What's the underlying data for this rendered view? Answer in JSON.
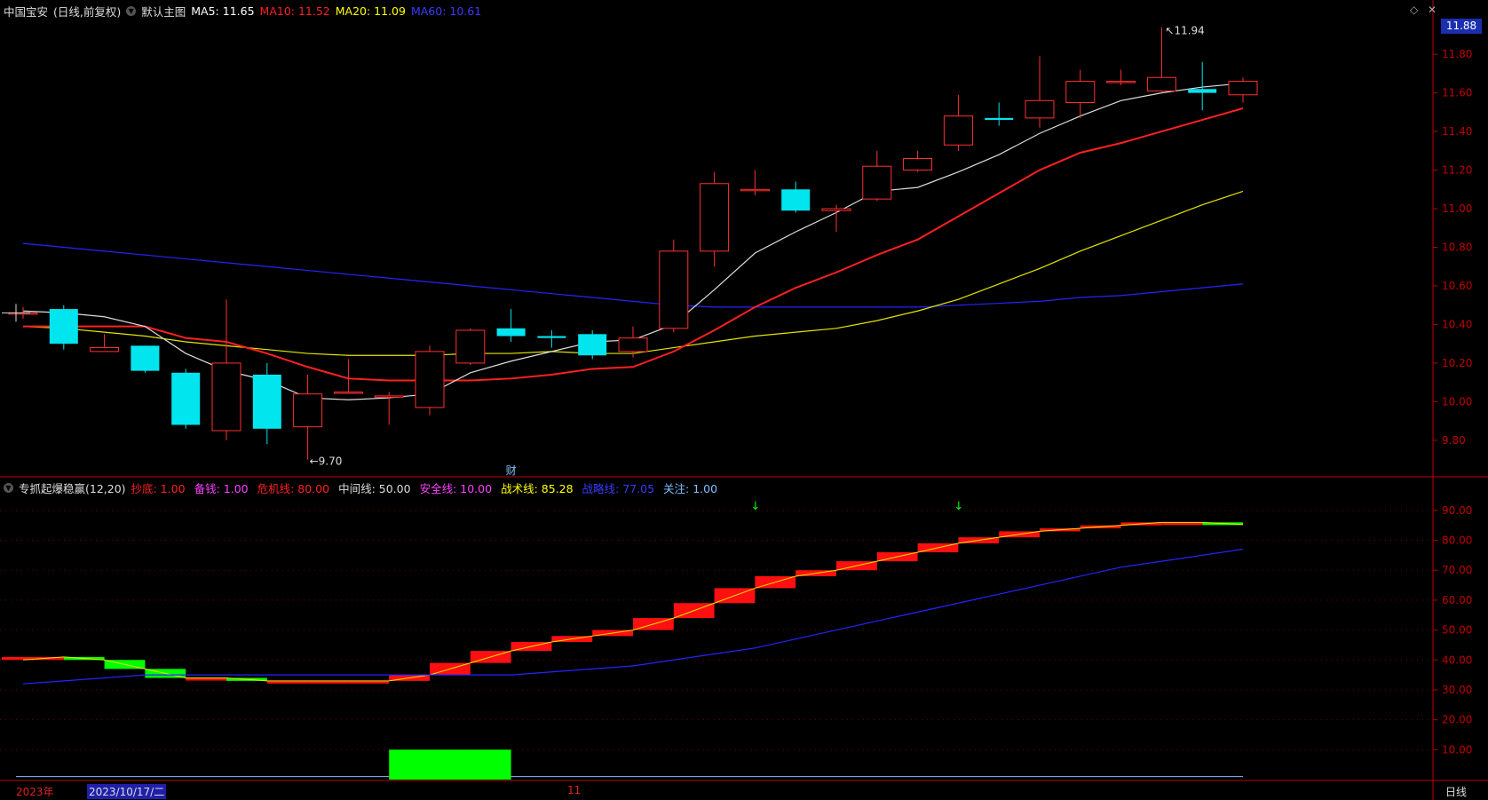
{
  "header": {
    "stock": "中国宝安",
    "mode": "(日线,前复权)",
    "chart_name": "默认主图",
    "ma": [
      {
        "label": "MA5: 11.65",
        "color": "#ffffff"
      },
      {
        "label": "MA10: 11.52",
        "color": "#ff2020"
      },
      {
        "label": "MA20: 11.09",
        "color": "#ffff00"
      },
      {
        "label": "MA60: 10.61",
        "color": "#3a3aff"
      }
    ]
  },
  "indicator_header": {
    "name": "专抓起爆稳赢(12,20)",
    "items": [
      {
        "label": "抄底: 1.00",
        "color": "#ff2020"
      },
      {
        "label": "备钱: 1.00",
        "color": "#ff40ff"
      },
      {
        "label": "危机线: 80.00",
        "color": "#ff2020"
      },
      {
        "label": "中间线: 50.00",
        "color": "#dddddd"
      },
      {
        "label": "安全线: 10.00",
        "color": "#ff40ff"
      },
      {
        "label": "战术线: 85.28",
        "color": "#ffff00"
      },
      {
        "label": "战略线: 77.05",
        "color": "#3a3aff"
      },
      {
        "label": "关注: 1.00",
        "color": "#80c0ff"
      }
    ]
  },
  "price_box": "11.88",
  "period": "日线",
  "bottom_axis": {
    "year": "2023年",
    "cursor_date": "2023/10/17/二",
    "month_mark": "11"
  },
  "annotations": {
    "high": "11.94",
    "low": "9.70",
    "fin_mark": "财"
  },
  "colors": {
    "up": "#ff3030",
    "down": "#00e5ee",
    "ma5": "#dddddd",
    "ma10": "#ff2020",
    "ma20": "#e6e600",
    "ma60": "#2424ff",
    "axis": "#c00000"
  },
  "chart_data": [
    {
      "type": "candlestick",
      "title": "中国宝安 (日线,前复权)",
      "ylim": [
        9.62,
        11.98
      ],
      "y_ticks": [
        "11.80",
        "11.60",
        "11.40",
        "11.20",
        "11.00",
        "10.80",
        "10.60",
        "10.40",
        "10.20",
        "10.00",
        "9.80"
      ],
      "y_tick_values": [
        11.8,
        11.6,
        11.4,
        11.2,
        11.0,
        10.8,
        10.6,
        10.4,
        10.2,
        10.0,
        9.8
      ],
      "candles": [
        {
          "o": 10.46,
          "c": 10.46,
          "h": 10.49,
          "l": 10.43
        },
        {
          "o": 10.48,
          "c": 10.3,
          "h": 10.5,
          "l": 10.27
        },
        {
          "o": 10.26,
          "c": 10.28,
          "h": 10.35,
          "l": 10.26
        },
        {
          "o": 10.29,
          "c": 10.16,
          "h": 10.29,
          "l": 10.15
        },
        {
          "o": 10.15,
          "c": 9.88,
          "h": 10.17,
          "l": 9.86
        },
        {
          "o": 9.85,
          "c": 10.2,
          "h": 10.53,
          "l": 9.8
        },
        {
          "o": 10.14,
          "c": 9.86,
          "h": 10.2,
          "l": 9.78
        },
        {
          "o": 9.87,
          "c": 10.04,
          "h": 10.14,
          "l": 9.7
        },
        {
          "o": 10.05,
          "c": 10.05,
          "h": 10.22,
          "l": 10.04
        },
        {
          "o": 10.03,
          "c": 10.03,
          "h": 10.05,
          "l": 9.88
        },
        {
          "o": 9.97,
          "c": 10.26,
          "h": 10.29,
          "l": 9.93
        },
        {
          "o": 10.2,
          "c": 10.37,
          "h": 10.38,
          "l": 10.19
        },
        {
          "o": 10.38,
          "c": 10.34,
          "h": 10.48,
          "l": 10.31
        },
        {
          "o": 10.34,
          "c": 10.33,
          "h": 10.37,
          "l": 10.28
        },
        {
          "o": 10.35,
          "c": 10.24,
          "h": 10.37,
          "l": 10.22
        },
        {
          "o": 10.26,
          "c": 10.33,
          "h": 10.39,
          "l": 10.23
        },
        {
          "o": 10.38,
          "c": 10.78,
          "h": 10.84,
          "l": 10.36
        },
        {
          "o": 10.78,
          "c": 11.13,
          "h": 11.19,
          "l": 10.7
        },
        {
          "o": 11.1,
          "c": 11.1,
          "h": 11.2,
          "l": 11.07
        },
        {
          "o": 11.1,
          "c": 10.99,
          "h": 11.14,
          "l": 10.98
        },
        {
          "o": 10.99,
          "c": 11.0,
          "h": 11.02,
          "l": 10.88
        },
        {
          "o": 11.05,
          "c": 11.22,
          "h": 11.3,
          "l": 11.04
        },
        {
          "o": 11.2,
          "c": 11.26,
          "h": 11.3,
          "l": 11.19
        },
        {
          "o": 11.33,
          "c": 11.48,
          "h": 11.59,
          "l": 11.3
        },
        {
          "o": 11.47,
          "c": 11.46,
          "h": 11.55,
          "l": 11.43
        },
        {
          "o": 11.47,
          "c": 11.56,
          "h": 11.79,
          "l": 11.42
        },
        {
          "o": 11.55,
          "c": 11.66,
          "h": 11.72,
          "l": 11.47
        },
        {
          "o": 11.66,
          "c": 11.66,
          "h": 11.72,
          "l": 11.64
        },
        {
          "o": 11.61,
          "c": 11.68,
          "h": 11.94,
          "l": 11.6
        },
        {
          "o": 11.62,
          "c": 11.6,
          "h": 11.76,
          "l": 11.51
        },
        {
          "o": 11.59,
          "c": 11.66,
          "h": 11.68,
          "l": 11.55
        }
      ],
      "series": [
        {
          "name": "MA5",
          "values": [
            10.47,
            10.46,
            10.44,
            10.39,
            10.25,
            10.16,
            10.11,
            10.02,
            10.01,
            10.02,
            10.04,
            10.15,
            10.21,
            10.26,
            10.31,
            10.32,
            10.4,
            10.58,
            10.77,
            10.88,
            10.98,
            11.09,
            11.11,
            11.19,
            11.28,
            11.39,
            11.48,
            11.56,
            11.6,
            11.63,
            11.65
          ]
        },
        {
          "name": "MA10",
          "values": [
            10.39,
            10.39,
            10.39,
            10.39,
            10.33,
            10.31,
            10.25,
            10.18,
            10.12,
            10.11,
            10.11,
            10.11,
            10.12,
            10.14,
            10.17,
            10.18,
            10.26,
            10.37,
            10.49,
            10.59,
            10.67,
            10.76,
            10.84,
            10.96,
            11.08,
            11.2,
            11.29,
            11.34,
            11.4,
            11.46,
            11.52
          ]
        },
        {
          "name": "MA20",
          "values": [
            10.39,
            10.38,
            10.36,
            10.34,
            10.31,
            10.29,
            10.27,
            10.25,
            10.24,
            10.24,
            10.24,
            10.25,
            10.25,
            10.26,
            10.25,
            10.25,
            10.28,
            10.31,
            10.34,
            10.36,
            10.38,
            10.42,
            10.47,
            10.53,
            10.61,
            10.69,
            10.78,
            10.86,
            10.94,
            11.02,
            11.09
          ]
        },
        {
          "name": "MA60",
          "values": [
            10.82,
            10.8,
            10.78,
            10.76,
            10.74,
            10.72,
            10.7,
            10.68,
            10.66,
            10.64,
            10.62,
            10.6,
            10.58,
            10.56,
            10.54,
            10.52,
            10.5,
            10.49,
            10.49,
            10.49,
            10.49,
            10.49,
            10.49,
            10.5,
            10.51,
            10.52,
            10.54,
            10.55,
            10.57,
            10.59,
            10.61
          ]
        }
      ]
    },
    {
      "type": "area",
      "title": "专抓起爆稳赢(12,20)",
      "ylim": [
        0,
        95
      ],
      "y_ticks": [
        "90.00",
        "80.00",
        "70.00",
        "60.00",
        "50.00",
        "40.00",
        "30.00",
        "20.00",
        "10.00"
      ],
      "y_tick_values": [
        90,
        80,
        70,
        60,
        50,
        40,
        30,
        20,
        10
      ],
      "series": [
        {
          "name": "战术线",
          "values": [
            40,
            41,
            40,
            37,
            34,
            34,
            33,
            33,
            33,
            33,
            35,
            39,
            43,
            46,
            48,
            50,
            54,
            59,
            64,
            68,
            70,
            73,
            76,
            79,
            81,
            83,
            84,
            85,
            86,
            86,
            85.28
          ]
        },
        {
          "name": "战略线",
          "values": [
            32,
            33,
            34,
            35,
            35,
            35,
            35,
            35,
            35,
            35,
            35,
            35,
            35,
            36,
            37,
            38,
            40,
            42,
            44,
            47,
            50,
            53,
            56,
            59,
            62,
            65,
            68,
            71,
            73,
            75,
            77.05
          ]
        }
      ],
      "green_bar_range": [
        9,
        12
      ],
      "arrow_indices": [
        18,
        23
      ]
    }
  ]
}
